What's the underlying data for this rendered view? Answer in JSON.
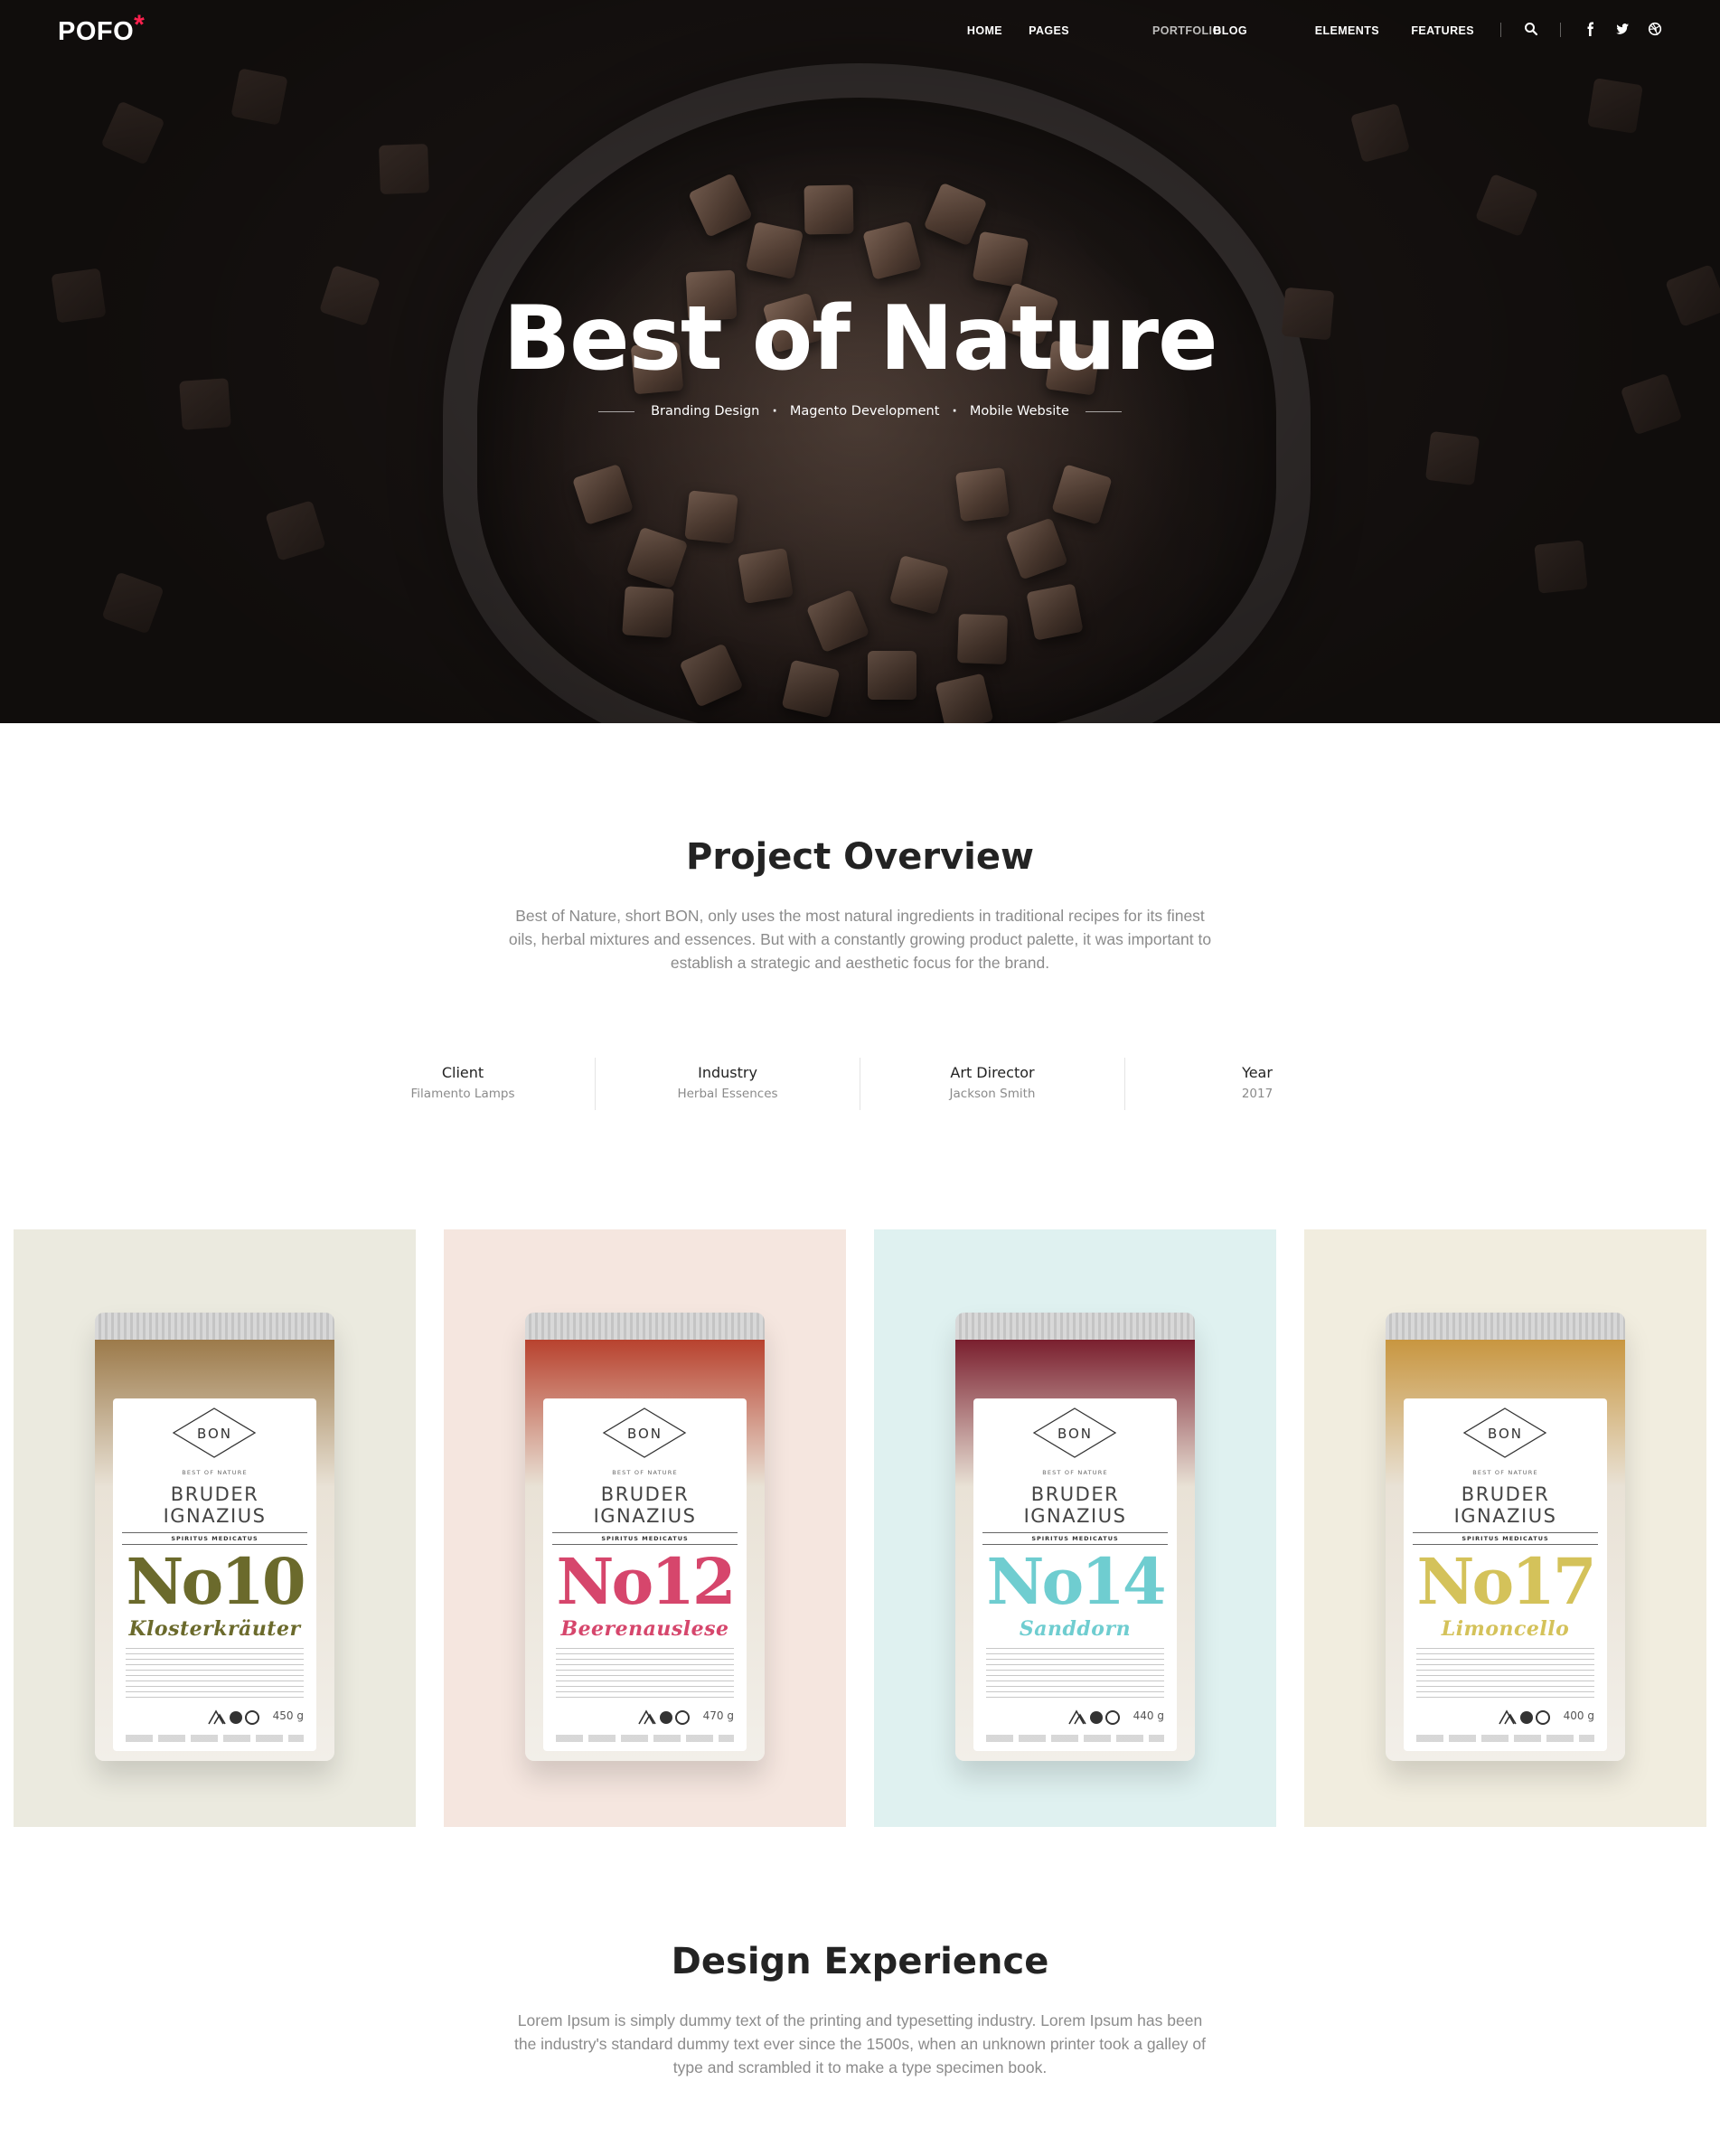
{
  "nav": {
    "logo": "POFO",
    "logo_mark": "*",
    "items": [
      "HOME",
      "PAGES",
      "PORTFOLIO",
      "BLOG",
      "ELEMENTS",
      "FEATURES"
    ],
    "active_item": "PORTFOLIO",
    "icons": [
      "search-icon",
      "facebook-icon",
      "twitter-icon",
      "dribbble-icon"
    ]
  },
  "hero": {
    "title": "Best of Nature",
    "tags": [
      "Branding Design",
      "Magento Development",
      "Mobile Website"
    ]
  },
  "overview": {
    "title": "Project Overview",
    "text": "Best of Nature, short BON, only uses the most natural ingredients in traditional recipes for its finest oils, herbal mixtures and essences. But with a constantly growing product palette, it was important to establish a strategic and aesthetic focus for the brand.",
    "meta": [
      {
        "label": "Client",
        "value": "Filamento Lamps"
      },
      {
        "label": "Industry",
        "value": "Herbal Essences"
      },
      {
        "label": "Art Director",
        "value": "Jackson Smith"
      },
      {
        "label": "Year",
        "value": "2017"
      }
    ]
  },
  "products": [
    {
      "brand": "BON",
      "tagline": "BEST OF NATURE",
      "name_line1": "BRUDER",
      "name_line2": "IGNAZIUS",
      "band": "SPIRITUS MEDICATUS",
      "number": "No10",
      "variety": "Klosterkräuter",
      "weight": "450 g",
      "bg": "#ebeadf",
      "accent": "#6b6a2c",
      "fill": "#9c7a4a"
    },
    {
      "brand": "BON",
      "tagline": "BEST OF NATURE",
      "name_line1": "BRUDER",
      "name_line2": "IGNAZIUS",
      "band": "SPIRITUS MEDICATUS",
      "number": "No12",
      "variety": "Beerenauslese",
      "weight": "470 g",
      "bg": "#f5e6df",
      "accent": "#d6466c",
      "fill": "#b8422e"
    },
    {
      "brand": "BON",
      "tagline": "BEST OF NATURE",
      "name_line1": "BRUDER",
      "name_line2": "IGNAZIUS",
      "band": "SPIRITUS MEDICATUS",
      "number": "No14",
      "variety": "Sanddorn",
      "weight": "440 g",
      "bg": "#dff1f0",
      "accent": "#6fcdd0",
      "fill": "#7a1f2e"
    },
    {
      "brand": "BON",
      "tagline": "BEST OF NATURE",
      "name_line1": "BRUDER",
      "name_line2": "IGNAZIUS",
      "band": "SPIRITUS MEDICATUS",
      "number": "No17",
      "variety": "Limoncello",
      "weight": "400 g",
      "bg": "#f1eddf",
      "accent": "#d4c25a",
      "fill": "#c89640"
    }
  ],
  "design": {
    "title": "Design Experience",
    "text": "Lorem Ipsum is simply dummy text of the printing and typesetting industry. Lorem Ipsum has been the industry's standard dummy text ever since the 1500s, when an unknown printer took a galley of type and scrambled it to make a type specimen book."
  }
}
